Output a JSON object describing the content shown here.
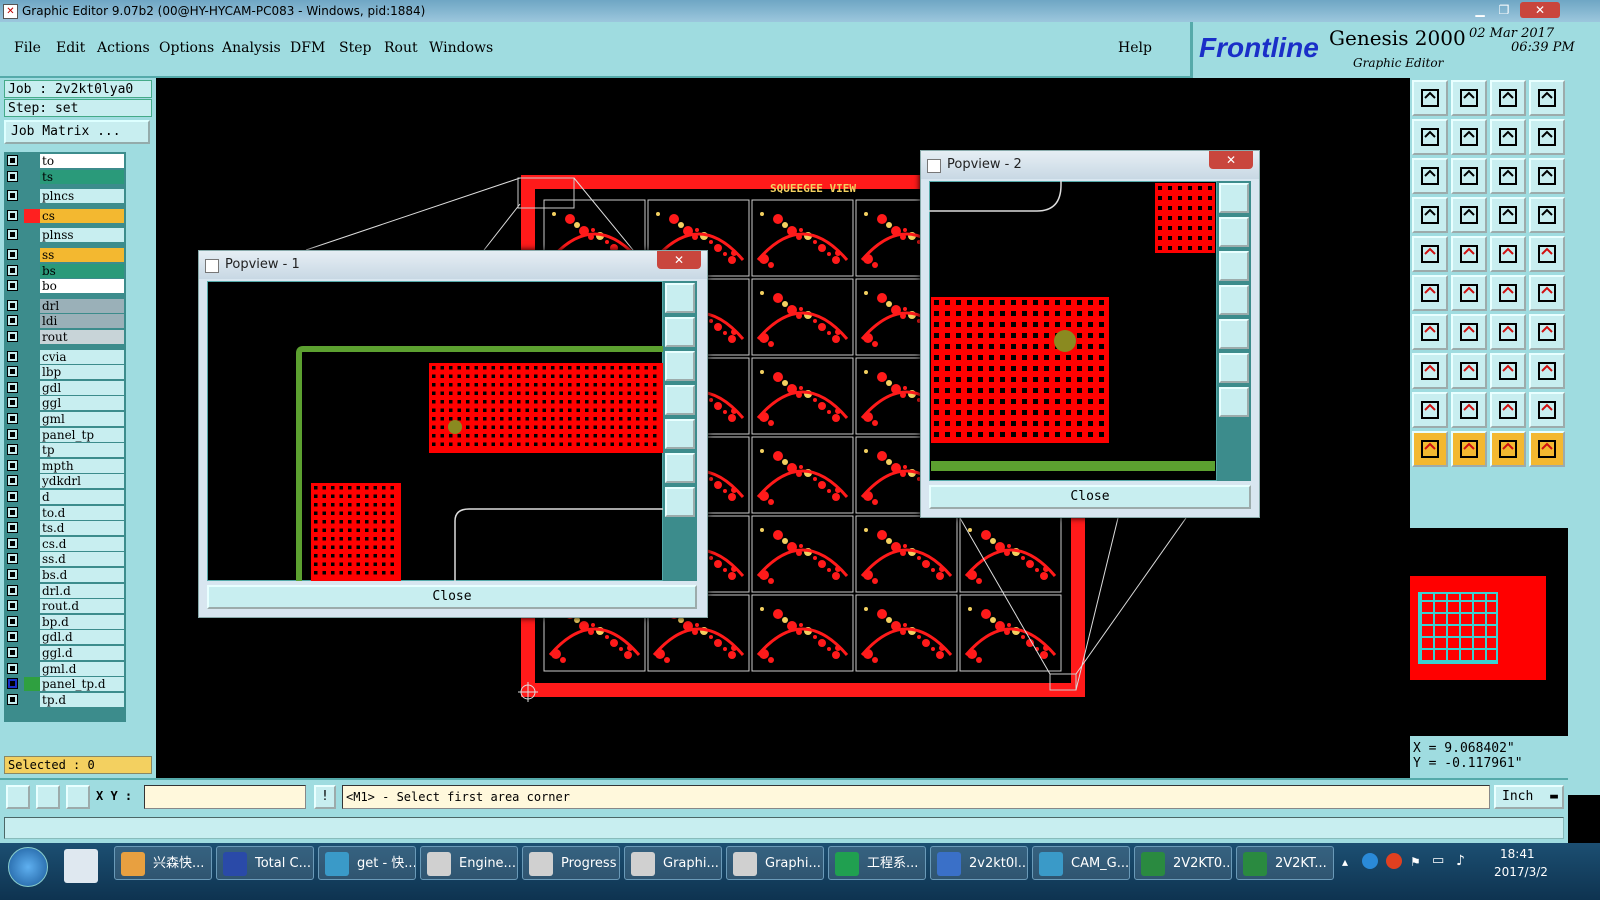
{
  "window": {
    "title": "Graphic Editor 9.07b2 (00@HY-HYCAM-PC083 - Windows, pid:1884)"
  },
  "menu": {
    "items": [
      "File",
      "Edit",
      "Actions",
      "Options",
      "Analysis",
      "DFM",
      "Step",
      "Rout",
      "Windows"
    ],
    "help": "Help"
  },
  "brand": {
    "logo": "Frontline",
    "product": "Genesis 2000",
    "subtitle": "Graphic Editor",
    "date": "02 Mar 2017",
    "time": "06:39 PM"
  },
  "job": {
    "job_line": "Job : 2v2kt0lya0",
    "step_line": "Step: set",
    "matrix_button": "Job Matrix ..."
  },
  "layers": [
    {
      "name": "to",
      "color": "#ffffff"
    },
    {
      "name": "ts",
      "color": "#2a9a7a"
    },
    {
      "name": "plncs",
      "color": "#c8eef0"
    },
    {
      "name": "cs",
      "color": "#f3b830",
      "swatch": "#ff2020"
    },
    {
      "name": "plnss",
      "color": "#c8eef0"
    },
    {
      "name": "ss",
      "color": "#f3b830"
    },
    {
      "name": "bs",
      "color": "#2a9a7a"
    },
    {
      "name": "bo",
      "color": "#ffffff"
    },
    {
      "name": "drl",
      "color": "#9ab0b8"
    },
    {
      "name": "ldi",
      "color": "#9ab0b8"
    },
    {
      "name": "rout",
      "color": "#c8d4d8"
    },
    {
      "name": "cvia",
      "color": "#c8eef0"
    },
    {
      "name": "lbp",
      "color": "#c8eef0"
    },
    {
      "name": "gdl",
      "color": "#c8eef0"
    },
    {
      "name": "ggl",
      "color": "#c8eef0"
    },
    {
      "name": "gml",
      "color": "#c8eef0"
    },
    {
      "name": "panel_tp",
      "color": "#c8eef0"
    },
    {
      "name": "tp",
      "color": "#c8eef0"
    },
    {
      "name": "mpth",
      "color": "#c8eef0"
    },
    {
      "name": "ydkdrl",
      "color": "#c8eef0"
    },
    {
      "name": "d",
      "color": "#c8eef0"
    },
    {
      "name": "to.d",
      "color": "#c8eef0"
    },
    {
      "name": "ts.d",
      "color": "#c8eef0"
    },
    {
      "name": "cs.d",
      "color": "#c8eef0"
    },
    {
      "name": "ss.d",
      "color": "#c8eef0"
    },
    {
      "name": "bs.d",
      "color": "#c8eef0"
    },
    {
      "name": "drl.d",
      "color": "#c8eef0"
    },
    {
      "name": "rout.d",
      "color": "#c8eef0"
    },
    {
      "name": "bp.d",
      "color": "#c8eef0"
    },
    {
      "name": "gdl.d",
      "color": "#c8eef0"
    },
    {
      "name": "ggl.d",
      "color": "#c8eef0"
    },
    {
      "name": "gml.d",
      "color": "#c8eef0"
    },
    {
      "name": "panel_tp.d",
      "color": "#c8eef0",
      "swatch": "#2fa040",
      "active": true
    },
    {
      "name": "tp.d",
      "color": "#c8eef0"
    }
  ],
  "selected": "Selected : 0",
  "canvas": {
    "panel_label": "SQUEEGEE VIEW",
    "colors": {
      "board": "#ff1a1a",
      "profile": "#5ca030",
      "pad": "#ff0000",
      "highlight": "#f3d060"
    }
  },
  "popview1": {
    "title": "Popview - 1",
    "close": "Close"
  },
  "popview2": {
    "title": "Popview - 2",
    "close": "Close"
  },
  "coords": {
    "x": "X = 9.068402\"",
    "y": "Y = -0.117961\""
  },
  "command": {
    "xy_label": "X Y :",
    "xy_value": "",
    "prompt": "<M1> - Select first area corner",
    "units": "Inch"
  },
  "taskbar": {
    "tasks": [
      "兴森快...",
      "Total C...",
      "get - 快...",
      "Engine...",
      "Progress",
      "Graphi...",
      "Graphi...",
      "工程系...",
      "2v2kt0l...",
      "CAM_G...",
      "2V2KT0...",
      "2V2KT..."
    ],
    "time": "18:41",
    "date": "2017/3/2"
  },
  "toolbar_icons": [
    "zoom-home-icon",
    "zoom-out-icon",
    "home-icon",
    "window-icon",
    "pan-left-icon",
    "pan-right-icon",
    "rotate-icon",
    "snap-icon",
    "fit-icon",
    "center-icon",
    "scale-1-2-icon",
    "help-icon",
    "measure-icon",
    "grid-icon",
    "layer-compare-icon",
    "layer-tools-icon",
    "pad-icon",
    "polygon-icon",
    "ruler-icon",
    "circle-icon",
    "connect-icon",
    "cross-icon",
    "line-add-icon",
    "line-move-icon",
    "angle-icon",
    "slope-icon",
    "arc-icon",
    "split-icon",
    "pad-move-icon",
    "line-icon",
    "resize-icon",
    "copy-icon",
    "triangle-icon",
    "tri-a-icon",
    "tri-b-icon",
    "tri-c-icon",
    "pointer-icon",
    "pointer-box-icon",
    "pointer-sel-icon",
    "pointer-multi-icon"
  ]
}
